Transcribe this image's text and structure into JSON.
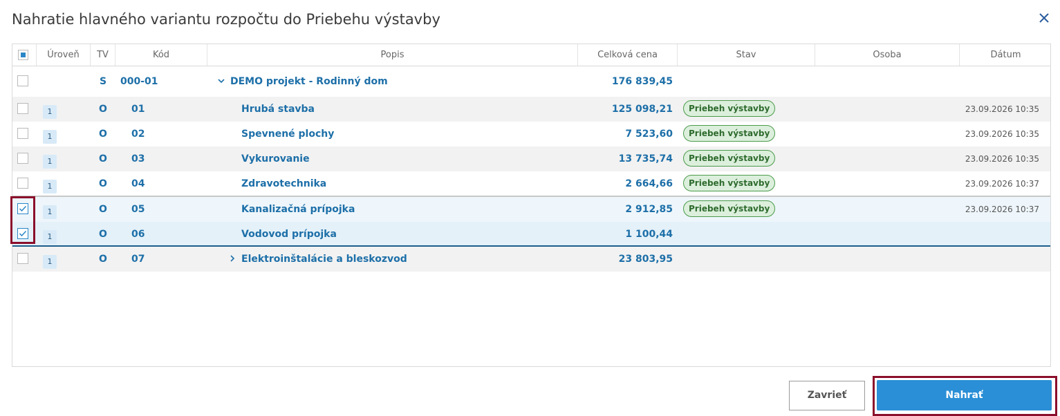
{
  "dialog": {
    "title": "Nahratie hlavného variantu rozpočtu do Priebehu výstavby"
  },
  "columns": {
    "level": "Úroveň",
    "tv": "TV",
    "code": "Kód",
    "description": "Popis",
    "total": "Celková cena",
    "status": "Stav",
    "person": "Osoba",
    "date": "Dátum"
  },
  "rows": [
    {
      "checked": false,
      "level": "",
      "tv": "S",
      "code": "000-01",
      "description": "DEMO projekt - Rodinný dom",
      "total": "176 839,45",
      "status": "",
      "date": "",
      "expand": "expanded"
    },
    {
      "checked": false,
      "level": "1",
      "tv": "O",
      "code": "01",
      "description": "Hrubá stavba",
      "total": "125 098,21",
      "status": "Priebeh výstavby",
      "date": "23.09.2026 10:35"
    },
    {
      "checked": false,
      "level": "1",
      "tv": "O",
      "code": "02",
      "description": "Spevnené plochy",
      "total": "7 523,60",
      "status": "Priebeh výstavby",
      "date": "23.09.2026 10:35"
    },
    {
      "checked": false,
      "level": "1",
      "tv": "O",
      "code": "03",
      "description": "Vykurovanie",
      "total": "13 735,74",
      "status": "Priebeh výstavby",
      "date": "23.09.2026 10:35"
    },
    {
      "checked": false,
      "level": "1",
      "tv": "O",
      "code": "04",
      "description": "Zdravotechnika",
      "total": "2 664,66",
      "status": "Priebeh výstavby",
      "date": "23.09.2026 10:37"
    },
    {
      "checked": true,
      "level": "1",
      "tv": "O",
      "code": "05",
      "description": "Kanalizačná prípojka",
      "total": "2 912,85",
      "status": "Priebeh výstavby",
      "date": "23.09.2026 10:37"
    },
    {
      "checked": true,
      "level": "1",
      "tv": "O",
      "code": "06",
      "description": "Vodovod prípojka",
      "total": "1 100,44",
      "status": "",
      "date": ""
    },
    {
      "checked": false,
      "level": "1",
      "tv": "O",
      "code": "07",
      "description": "Elektroinštalácie a bleskozvod",
      "total": "23 803,95",
      "status": "",
      "date": "",
      "expand": "collapsed"
    }
  ],
  "buttons": {
    "close": "Zavrieť",
    "upload": "Nahrať"
  },
  "colors": {
    "accent": "#2a8fd6",
    "highlight": "#8b0e2b",
    "status_green": "#2e6b2e"
  }
}
